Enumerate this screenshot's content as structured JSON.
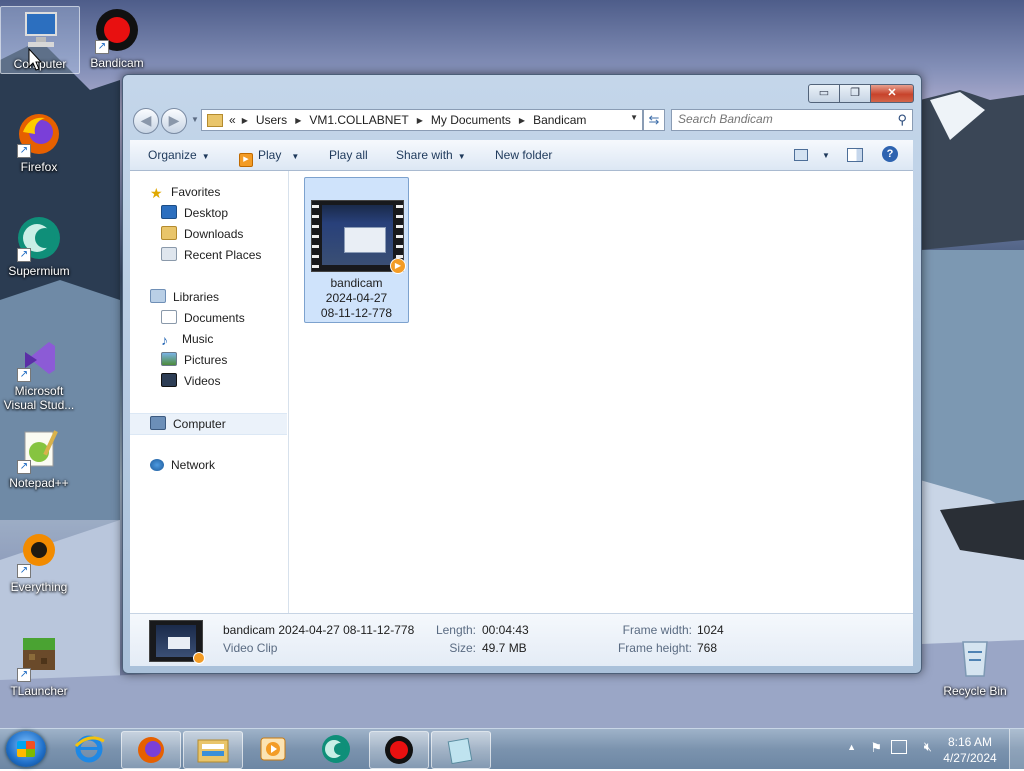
{
  "desktop": {
    "icons": [
      {
        "label": "Computer"
      },
      {
        "label": "Bandicam"
      },
      {
        "label": "Firefox"
      },
      {
        "label": "Supermium"
      },
      {
        "label": "Microsoft Visual Stud..."
      },
      {
        "label": "Notepad++"
      },
      {
        "label": "Everything"
      },
      {
        "label": "TLauncher"
      },
      {
        "label": "Recycle Bin"
      }
    ]
  },
  "window": {
    "controls": {
      "minimize": "▭",
      "maximize": "❐",
      "close": "✕"
    },
    "address": {
      "overflow": "«",
      "crumbs": [
        "Users",
        "VM1.COLLABNET",
        "My Documents",
        "Bandicam"
      ]
    },
    "search": {
      "placeholder": "Search Bandicam"
    },
    "toolbar": {
      "organize": "Organize",
      "play": "Play",
      "play_all": "Play all",
      "share_with": "Share with",
      "new_folder": "New folder"
    },
    "nav": {
      "favorites": "Favorites",
      "desktop": "Desktop",
      "downloads": "Downloads",
      "recent_places": "Recent Places",
      "libraries": "Libraries",
      "documents": "Documents",
      "music": "Music",
      "pictures": "Pictures",
      "videos": "Videos",
      "computer": "Computer",
      "network": "Network"
    },
    "files": [
      {
        "line1": "bandicam",
        "line2": "2024-04-27",
        "line3": "08-11-12-778"
      }
    ],
    "details": {
      "name": "bandicam 2024-04-27 08-11-12-778",
      "type": "Video Clip",
      "length_label": "Length:",
      "length_value": "00:04:43",
      "size_label": "Size:",
      "size_value": "49.7 MB",
      "frame_width_label": "Frame width:",
      "frame_width_value": "1024",
      "frame_height_label": "Frame height:",
      "frame_height_value": "768"
    }
  },
  "taskbar": {
    "clock_time": "8:16 AM",
    "clock_date": "4/27/2024"
  },
  "colors": {
    "window_frame": "#c4d6ea",
    "selection": "#cfe3fb",
    "taskbar": "#7b93ae"
  }
}
